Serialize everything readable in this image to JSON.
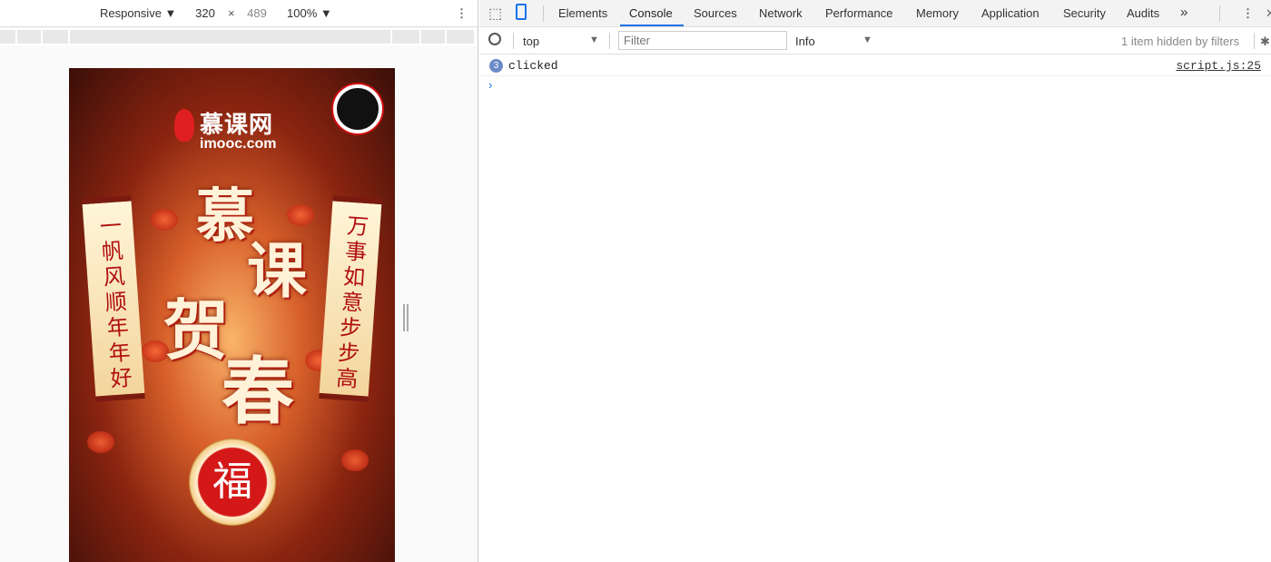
{
  "device_toolbar": {
    "device": "Responsive",
    "width": "320",
    "times": "×",
    "height": "489",
    "zoom": "100%",
    "more": "⋮"
  },
  "poster": {
    "logo_cn": "慕课网",
    "logo_en": "imooc.com",
    "left_couplet": "一帆风顺年年好",
    "right_couplet": "万事如意步步高",
    "title_1": "慕",
    "title_2": "课",
    "title_3": "贺",
    "title_4": "春",
    "seal": "福"
  },
  "devtools": {
    "tabs": [
      "Elements",
      "Console",
      "Sources",
      "Network",
      "Performance",
      "Memory",
      "Application",
      "Security",
      "Audits"
    ],
    "overflow": "»",
    "more": "⋮",
    "close": "✕"
  },
  "console_toolbar": {
    "context": "top",
    "filter_placeholder": "Filter",
    "level": "Info",
    "hidden": "1 item hidden by filters"
  },
  "messages": [
    {
      "count": "3",
      "text": "clicked",
      "source": "script.js:25"
    }
  ],
  "prompt": "›"
}
